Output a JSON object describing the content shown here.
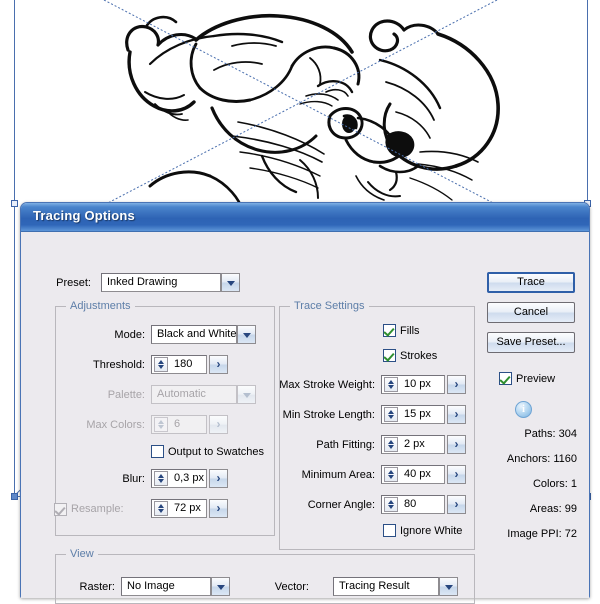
{
  "dialog": {
    "title": "Tracing Options",
    "preset": {
      "label": "Preset:",
      "value": "Inked Drawing"
    },
    "adjustments": {
      "legend": "Adjustments",
      "mode": {
        "label": "Mode:",
        "value": "Black and White"
      },
      "threshold": {
        "label": "Threshold:",
        "value": "180"
      },
      "palette": {
        "label": "Palette:",
        "value": "Automatic"
      },
      "max_colors": {
        "label": "Max Colors:",
        "value": "6"
      },
      "output_to_swatches": {
        "label": "Output to Swatches",
        "checked": false
      },
      "blur": {
        "label": "Blur:",
        "value": "0,3 px"
      },
      "resample": {
        "label": "Resample:",
        "value": "72 px",
        "checked": true
      }
    },
    "trace_settings": {
      "legend": "Trace Settings",
      "fills": {
        "label": "Fills",
        "checked": true
      },
      "strokes": {
        "label": "Strokes",
        "checked": true
      },
      "max_stroke_weight": {
        "label": "Max Stroke Weight:",
        "value": "10 px"
      },
      "min_stroke_length": {
        "label": "Min Stroke Length:",
        "value": "15 px"
      },
      "path_fitting": {
        "label": "Path Fitting:",
        "value": "2 px"
      },
      "minimum_area": {
        "label": "Minimum Area:",
        "value": "40 px"
      },
      "corner_angle": {
        "label": "Corner Angle:",
        "value": "80"
      },
      "ignore_white": {
        "label": "Ignore White",
        "checked": false
      }
    },
    "view": {
      "legend": "View",
      "raster": {
        "label": "Raster:",
        "value": "No Image"
      },
      "vector": {
        "label": "Vector:",
        "value": "Tracing Result"
      }
    },
    "buttons": {
      "trace": "Trace",
      "cancel": "Cancel",
      "save_preset": "Save Preset..."
    },
    "preview": {
      "label": "Preview",
      "checked": true
    },
    "stats": {
      "paths": "Paths: 304",
      "anchors": "Anchors: 1160",
      "colors": "Colors: 1",
      "areas": "Areas: 99",
      "image_ppi": "Image PPI: 72"
    }
  },
  "canvas": {
    "artwork_description": "ink line drawing of a cartoon mouse wearing a wide-brimmed hat",
    "selection_color": "#4a6fae"
  },
  "colors": {
    "titlebar_blue": "#2e63b4",
    "dialog_face": "#eceaee",
    "group_label": "#5d7ea8",
    "check_green": "#2f8f2f",
    "disabled_text": "#a7a4a8"
  }
}
